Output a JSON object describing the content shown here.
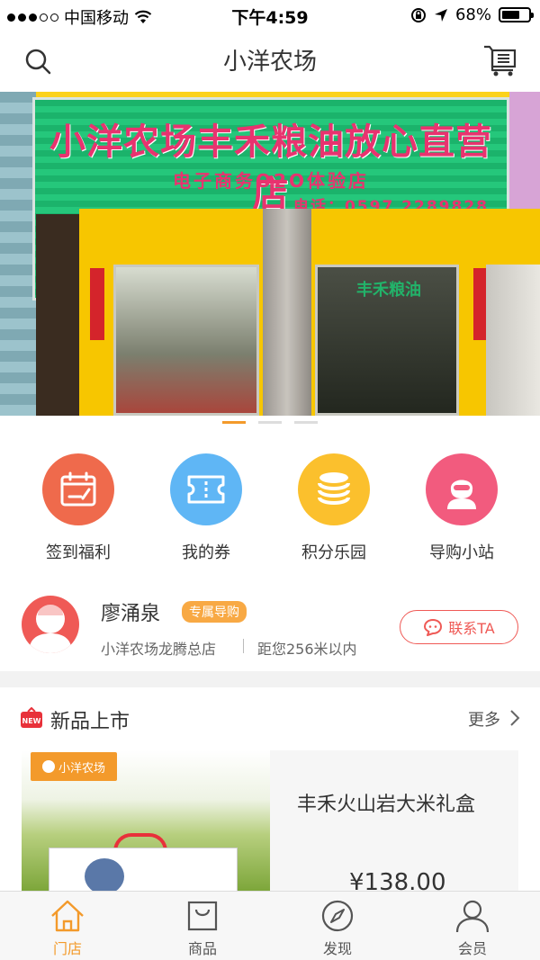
{
  "status_bar": {
    "carrier": "中国移动",
    "time": "下午4:59",
    "battery": "68%",
    "battery_level": 0.68
  },
  "nav": {
    "title": "小洋农场",
    "search_icon": "search-icon",
    "cart_icon": "cart-icon"
  },
  "banner": {
    "sign_main": "小洋农场丰禾粮油放心直营店",
    "sign_sub": "电子商务O2O体验店",
    "sign_phone": "电话：0597  2289828",
    "shop_text": "丰禾粮油",
    "indicator_count": 3,
    "active_index": 0
  },
  "quick_actions": [
    {
      "label": "签到福利",
      "icon": "calendar-icon",
      "color": "#ef6a4c"
    },
    {
      "label": "我的券",
      "icon": "ticket-icon",
      "color": "#5fb6f5"
    },
    {
      "label": "积分乐园",
      "icon": "coins-icon",
      "color": "#fbc02d"
    },
    {
      "label": "导购小站",
      "icon": "shopping-guide-icon",
      "color": "#f25b7e"
    }
  ],
  "guide": {
    "name": "廖涌泉",
    "tag": "专属导购",
    "store": "小洋农场龙腾总店",
    "distance": "距您256米以内",
    "contact_label": "联系TA"
  },
  "new_products": {
    "title": "新品上市",
    "more_label": "更多",
    "badge": "NEW",
    "items": [
      {
        "name": "丰禾火山岩大米礼盒",
        "price": "¥138.00",
        "brand": "小洋农场"
      }
    ]
  },
  "tabs": [
    {
      "label": "门店",
      "icon": "store-icon",
      "active": true
    },
    {
      "label": "商品",
      "icon": "bag-icon",
      "active": false
    },
    {
      "label": "发现",
      "icon": "compass-icon",
      "active": false
    },
    {
      "label": "会员",
      "icon": "user-icon",
      "active": false
    }
  ]
}
